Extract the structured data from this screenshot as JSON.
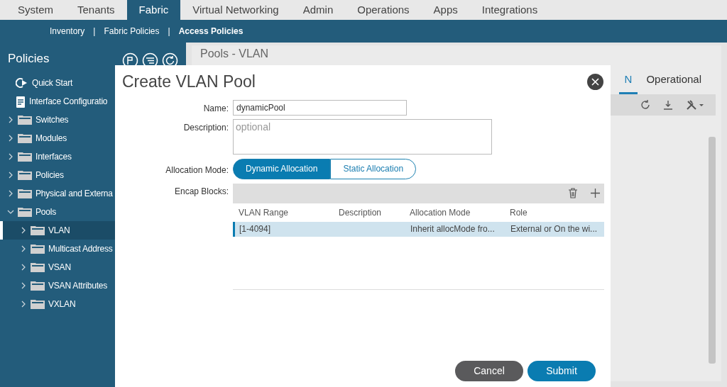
{
  "top_tabs": [
    {
      "label": "System",
      "selected": false
    },
    {
      "label": "Tenants",
      "selected": false
    },
    {
      "label": "Fabric",
      "selected": true
    },
    {
      "label": "Virtual Networking",
      "selected": false
    },
    {
      "label": "Admin",
      "selected": false
    },
    {
      "label": "Operations",
      "selected": false
    },
    {
      "label": "Apps",
      "selected": false
    },
    {
      "label": "Integrations",
      "selected": false
    }
  ],
  "sub_nav": [
    {
      "label": "Inventory",
      "selected": false
    },
    {
      "label": "Fabric Policies",
      "selected": false
    },
    {
      "label": "Access Policies",
      "selected": true
    }
  ],
  "sub_nav_separator": "|",
  "sidebar": {
    "title": "Policies",
    "items": [
      {
        "label": "Quick Start",
        "kind": "quickstart",
        "selected": false
      },
      {
        "label": "Interface Configuratio",
        "kind": "doc",
        "selected": false
      },
      {
        "label": "Switches",
        "kind": "folder",
        "expanded": false,
        "selected": false
      },
      {
        "label": "Modules",
        "kind": "folder",
        "expanded": false,
        "selected": false
      },
      {
        "label": "Interfaces",
        "kind": "folder",
        "expanded": false,
        "selected": false
      },
      {
        "label": "Policies",
        "kind": "folder",
        "expanded": false,
        "selected": false
      },
      {
        "label": "Physical and Externa",
        "kind": "folder",
        "expanded": false,
        "selected": false
      },
      {
        "label": "Pools",
        "kind": "folder",
        "expanded": true,
        "selected": false,
        "children": [
          {
            "label": "VLAN",
            "kind": "folder",
            "expanded": false,
            "selected": true
          },
          {
            "label": "Multicast Address",
            "kind": "folder",
            "expanded": false,
            "selected": false
          },
          {
            "label": "VSAN",
            "kind": "folder",
            "expanded": false,
            "selected": false
          },
          {
            "label": "VSAN Attributes",
            "kind": "folder",
            "expanded": false,
            "selected": false
          },
          {
            "label": "VXLAN",
            "kind": "folder",
            "expanded": false,
            "selected": false
          }
        ]
      }
    ]
  },
  "background_panel": {
    "title": "Pools - VLAN",
    "tabs": [
      {
        "label": "N",
        "selected": true
      },
      {
        "label": "Operational",
        "selected": false
      }
    ]
  },
  "dialog": {
    "title": "Create VLAN Pool",
    "name": {
      "label": "Name:",
      "value": "dynamicPool"
    },
    "description": {
      "label": "Description:",
      "placeholder": "optional"
    },
    "allocation_mode": {
      "label": "Allocation Mode:",
      "options": [
        {
          "label": "Dynamic Allocation",
          "selected": true
        },
        {
          "label": "Static Allocation",
          "selected": false
        }
      ]
    },
    "encap_blocks": {
      "label": "Encap Blocks:",
      "columns": [
        "VLAN Range",
        "Description",
        "Allocation Mode",
        "Role"
      ],
      "rows": [
        {
          "cells": [
            "[1-4094]",
            "",
            "Inherit allocMode fro...",
            "External or On the wi..."
          ],
          "selected": true
        }
      ]
    },
    "buttons": [
      {
        "label": "Cancel",
        "kind": "secondary"
      },
      {
        "label": "Submit",
        "kind": "primary"
      }
    ]
  }
}
